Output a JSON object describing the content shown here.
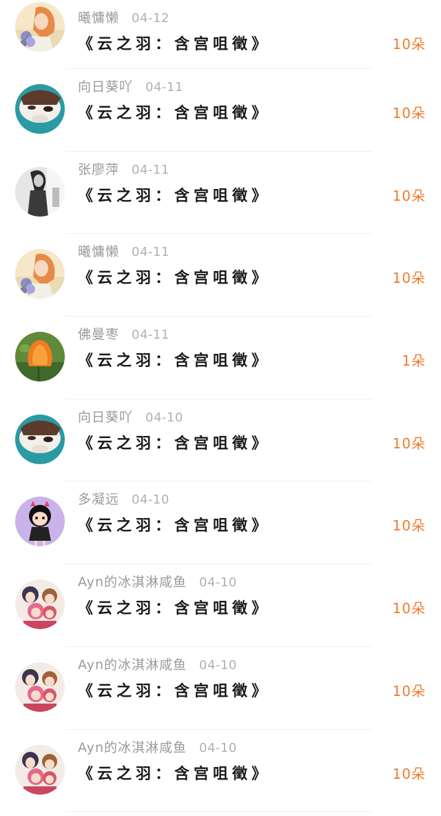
{
  "accent_color": "#f07a2a",
  "gifts": [
    {
      "user": "曦慵懒",
      "date": "04-12",
      "title": "《云之羽：含宫咀徵》",
      "amount": "10朵",
      "avatar": "avatar-girl-flowers"
    },
    {
      "user": "向日葵吖",
      "date": "04-11",
      "title": "《云之羽：含宫咀徵》",
      "amount": "10朵",
      "avatar": "avatar-dog"
    },
    {
      "user": "张廖萍",
      "date": "04-11",
      "title": "《云之羽：含宫咀徵》",
      "amount": "10朵",
      "avatar": "avatar-bw-woman"
    },
    {
      "user": "曦慵懒",
      "date": "04-11",
      "title": "《云之羽：含宫咀徵》",
      "amount": "10朵",
      "avatar": "avatar-girl-flowers"
    },
    {
      "user": "佛曼枣",
      "date": "04-11",
      "title": "《云之羽：含宫咀徵》",
      "amount": "1朵",
      "avatar": "avatar-orange-flower"
    },
    {
      "user": "向日葵吖",
      "date": "04-10",
      "title": "《云之羽：含宫咀徵》",
      "amount": "10朵",
      "avatar": "avatar-dog"
    },
    {
      "user": "多凝远",
      "date": "04-10",
      "title": "《云之羽：含宫咀徵》",
      "amount": "10朵",
      "avatar": "avatar-cartoon-girl"
    },
    {
      "user": "Ayn的冰淇淋咸鱼",
      "date": "04-10",
      "title": "《云之羽：含宫咀徵》",
      "amount": "10朵",
      "avatar": "avatar-anime-group"
    },
    {
      "user": "Ayn的冰淇淋咸鱼",
      "date": "04-10",
      "title": "《云之羽：含宫咀徵》",
      "amount": "10朵",
      "avatar": "avatar-anime-group"
    },
    {
      "user": "Ayn的冰淇淋咸鱼",
      "date": "04-10",
      "title": "《云之羽：含宫咀徵》",
      "amount": "10朵",
      "avatar": "avatar-anime-group"
    }
  ]
}
